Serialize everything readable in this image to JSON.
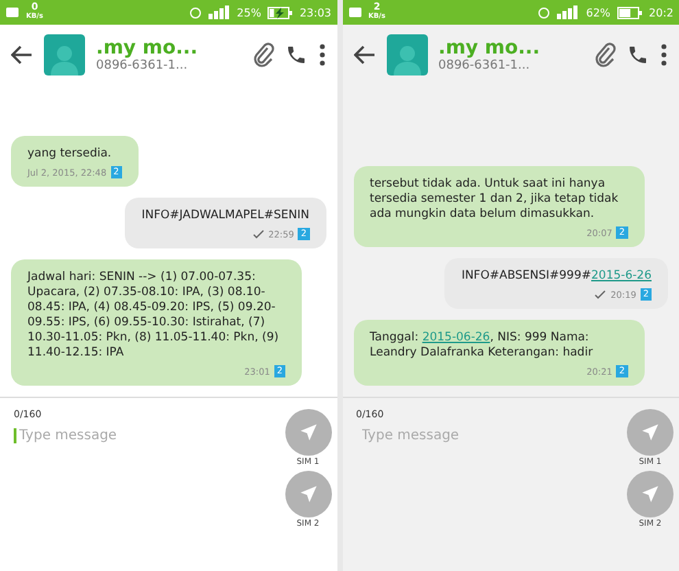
{
  "screens": [
    {
      "status_bar": {
        "speed": "0",
        "speed_unit": "KB/s",
        "battery": "25%",
        "level": 0.25,
        "charging": true,
        "time": "23:03"
      },
      "contact": {
        "name": ".my mo...",
        "number": "0896-6361-1..."
      },
      "messages": [
        {
          "kind": "in",
          "parts": [
            {
              "kind": "text",
              "text": "yang tersedia."
            }
          ],
          "time": "Jul 2, 2015, 22:48",
          "sim": "2"
        },
        {
          "kind": "out",
          "parts": [
            {
              "kind": "text",
              "text": "INFO#JADWALMAPEL#SENIN"
            }
          ],
          "time": "22:59",
          "sim": "2"
        },
        {
          "kind": "in",
          "parts": [
            {
              "kind": "text",
              "text": "Jadwal hari: SENIN --> (1) 07.00-07.35: Upacara, (2) 07.35-08.10: IPA, (3) 08.10-08.45: IPA, (4) 08.45-09.20: IPS, (5) 09.20-09.55: IPS, (6) 09.55-10.30: Istirahat, (7) 10.30-11.05: Pkn, (8) 11.05-11.40: Pkn, (9) 11.40-12.15: IPA"
            }
          ],
          "time": "23:01",
          "sim": "2"
        }
      ],
      "compose": {
        "counter": "0/160",
        "placeholder": "Type message",
        "focused": true
      },
      "send_buttons": [
        "SIM 1",
        "SIM 2"
      ]
    },
    {
      "status_bar": {
        "speed": "2",
        "speed_unit": "KB/s",
        "battery": "62%",
        "level": 0.62,
        "charging": false,
        "time": "20:2"
      },
      "contact": {
        "name": ".my mo...",
        "number": "0896-6361-1..."
      },
      "messages": [
        {
          "kind": "in",
          "parts": [
            {
              "kind": "text",
              "text": "tersebut tidak ada. Untuk saat ini hanya tersedia semester 1 dan 2, jika tetap tidak ada mungkin data belum dimasukkan."
            }
          ],
          "time": "20:07",
          "sim": "2"
        },
        {
          "kind": "out",
          "parts": [
            {
              "kind": "text",
              "text": "INFO#ABSENSI#999#"
            },
            {
              "kind": "link",
              "text": "2015-6-26"
            }
          ],
          "time": "20:19",
          "sim": "2"
        },
        {
          "kind": "in",
          "parts": [
            {
              "kind": "text",
              "text": "Tanggal: "
            },
            {
              "kind": "link",
              "text": "2015-06-26"
            },
            {
              "kind": "text",
              "text": ", NIS: 999 Nama: Leandry Dalafranka Keterangan: hadir"
            }
          ],
          "time": "20:21",
          "sim": "2"
        }
      ],
      "compose": {
        "counter": "0/160",
        "placeholder": "Type message",
        "focused": false
      },
      "send_buttons": [
        "SIM 1",
        "SIM 2"
      ]
    }
  ]
}
